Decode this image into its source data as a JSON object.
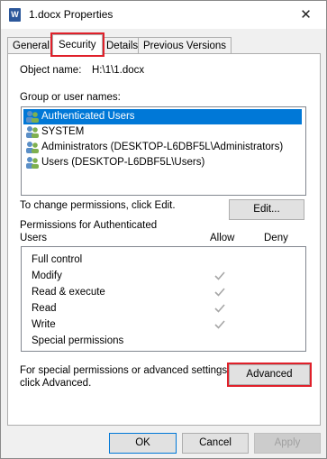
{
  "window": {
    "title": "1.docx Properties",
    "app_icon_glyph": "W",
    "close_glyph": "✕"
  },
  "tabs": [
    {
      "label": "General",
      "active": false
    },
    {
      "label": "Security",
      "active": true
    },
    {
      "label": "Details",
      "active": false
    },
    {
      "label": "Previous Versions",
      "active": false
    }
  ],
  "security": {
    "object_name_label": "Object name:",
    "object_name_value": "H:\\1\\1.docx",
    "group_label": "Group or user names:",
    "users": [
      {
        "name": "Authenticated Users",
        "selected": true
      },
      {
        "name": "SYSTEM",
        "selected": false
      },
      {
        "name": "Administrators (DESKTOP-L6DBF5L\\Administrators)",
        "selected": false
      },
      {
        "name": "Users (DESKTOP-L6DBF5L\\Users)",
        "selected": false
      }
    ],
    "change_text": "To change permissions, click Edit.",
    "edit_button": "Edit...",
    "permissions_label_line1": "Permissions for Authenticated",
    "permissions_label_line2": "Users",
    "allow_header": "Allow",
    "deny_header": "Deny",
    "permissions": [
      {
        "name": "Full control",
        "allow": false,
        "deny": false
      },
      {
        "name": "Modify",
        "allow": true,
        "deny": false
      },
      {
        "name": "Read & execute",
        "allow": true,
        "deny": false
      },
      {
        "name": "Read",
        "allow": true,
        "deny": false
      },
      {
        "name": "Write",
        "allow": true,
        "deny": false
      },
      {
        "name": "Special permissions",
        "allow": false,
        "deny": false
      }
    ],
    "advanced_text_line1": "For special permissions or advanced settings,",
    "advanced_text_line2": "click Advanced.",
    "advanced_button": "Advanced"
  },
  "footer": {
    "ok": "OK",
    "cancel": "Cancel",
    "apply": "Apply"
  },
  "colors": {
    "selection": "#0078d7",
    "highlight_red": "#e0202a",
    "check_gray": "#a6a6a6"
  },
  "icons": {
    "user_group": "users-icon",
    "check": "check-icon"
  }
}
